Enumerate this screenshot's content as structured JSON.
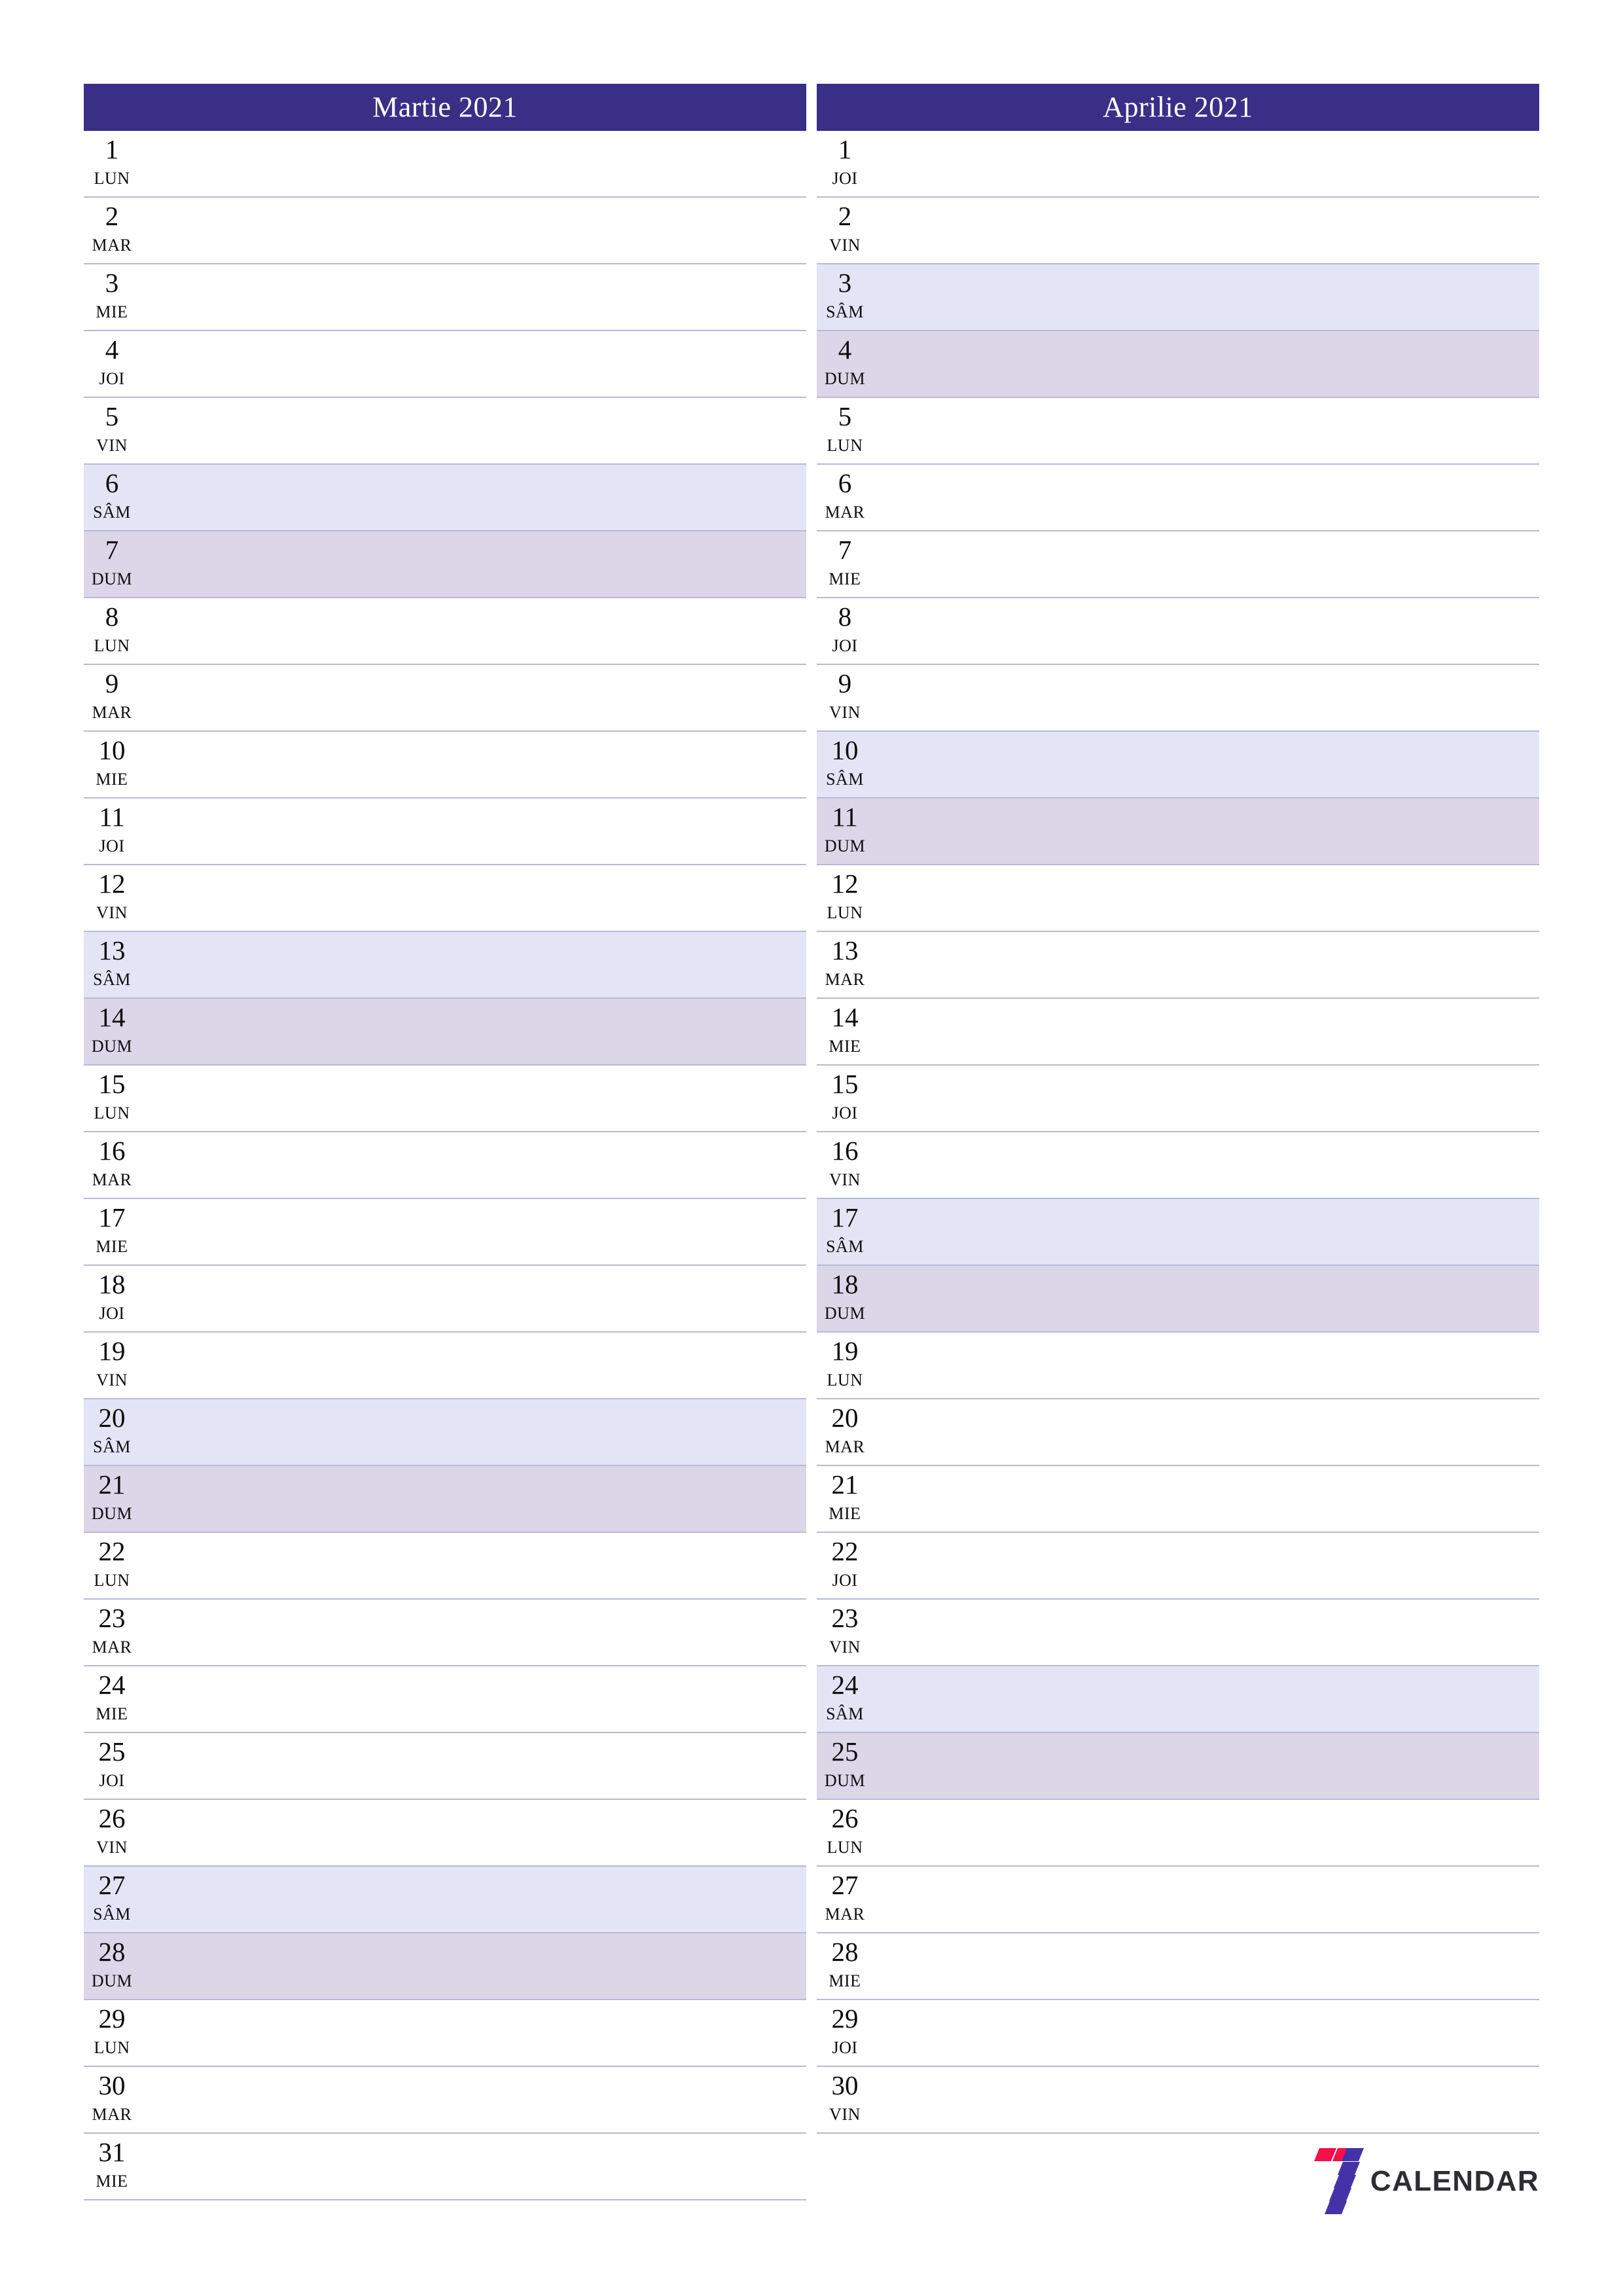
{
  "colors": {
    "header_bar": "#392f87",
    "saturday_row": "#e4e4f7",
    "sunday_row": "#dcd6e9",
    "row_separator": "#b9b9d6",
    "logo_red": "#f4104a",
    "logo_purple": "#4632a8",
    "logo_text": "#2d2d33"
  },
  "months": [
    {
      "title": "Martie 2021",
      "days": [
        {
          "num": "1",
          "abbr": "LUN",
          "type": "weekday"
        },
        {
          "num": "2",
          "abbr": "MAR",
          "type": "weekday"
        },
        {
          "num": "3",
          "abbr": "MIE",
          "type": "weekday"
        },
        {
          "num": "4",
          "abbr": "JOI",
          "type": "weekday"
        },
        {
          "num": "5",
          "abbr": "VIN",
          "type": "weekday"
        },
        {
          "num": "6",
          "abbr": "SÂM",
          "type": "saturday"
        },
        {
          "num": "7",
          "abbr": "DUM",
          "type": "sunday"
        },
        {
          "num": "8",
          "abbr": "LUN",
          "type": "weekday"
        },
        {
          "num": "9",
          "abbr": "MAR",
          "type": "weekday"
        },
        {
          "num": "10",
          "abbr": "MIE",
          "type": "weekday"
        },
        {
          "num": "11",
          "abbr": "JOI",
          "type": "weekday"
        },
        {
          "num": "12",
          "abbr": "VIN",
          "type": "weekday"
        },
        {
          "num": "13",
          "abbr": "SÂM",
          "type": "saturday"
        },
        {
          "num": "14",
          "abbr": "DUM",
          "type": "sunday"
        },
        {
          "num": "15",
          "abbr": "LUN",
          "type": "weekday"
        },
        {
          "num": "16",
          "abbr": "MAR",
          "type": "weekday"
        },
        {
          "num": "17",
          "abbr": "MIE",
          "type": "weekday"
        },
        {
          "num": "18",
          "abbr": "JOI",
          "type": "weekday"
        },
        {
          "num": "19",
          "abbr": "VIN",
          "type": "weekday"
        },
        {
          "num": "20",
          "abbr": "SÂM",
          "type": "saturday"
        },
        {
          "num": "21",
          "abbr": "DUM",
          "type": "sunday"
        },
        {
          "num": "22",
          "abbr": "LUN",
          "type": "weekday"
        },
        {
          "num": "23",
          "abbr": "MAR",
          "type": "weekday"
        },
        {
          "num": "24",
          "abbr": "MIE",
          "type": "weekday"
        },
        {
          "num": "25",
          "abbr": "JOI",
          "type": "weekday"
        },
        {
          "num": "26",
          "abbr": "VIN",
          "type": "weekday"
        },
        {
          "num": "27",
          "abbr": "SÂM",
          "type": "saturday"
        },
        {
          "num": "28",
          "abbr": "DUM",
          "type": "sunday"
        },
        {
          "num": "29",
          "abbr": "LUN",
          "type": "weekday"
        },
        {
          "num": "30",
          "abbr": "MAR",
          "type": "weekday"
        },
        {
          "num": "31",
          "abbr": "MIE",
          "type": "weekday"
        }
      ]
    },
    {
      "title": "Aprilie 2021",
      "days": [
        {
          "num": "1",
          "abbr": "JOI",
          "type": "weekday"
        },
        {
          "num": "2",
          "abbr": "VIN",
          "type": "weekday"
        },
        {
          "num": "3",
          "abbr": "SÂM",
          "type": "saturday"
        },
        {
          "num": "4",
          "abbr": "DUM",
          "type": "sunday"
        },
        {
          "num": "5",
          "abbr": "LUN",
          "type": "weekday"
        },
        {
          "num": "6",
          "abbr": "MAR",
          "type": "weekday"
        },
        {
          "num": "7",
          "abbr": "MIE",
          "type": "weekday"
        },
        {
          "num": "8",
          "abbr": "JOI",
          "type": "weekday"
        },
        {
          "num": "9",
          "abbr": "VIN",
          "type": "weekday"
        },
        {
          "num": "10",
          "abbr": "SÂM",
          "type": "saturday"
        },
        {
          "num": "11",
          "abbr": "DUM",
          "type": "sunday"
        },
        {
          "num": "12",
          "abbr": "LUN",
          "type": "weekday"
        },
        {
          "num": "13",
          "abbr": "MAR",
          "type": "weekday"
        },
        {
          "num": "14",
          "abbr": "MIE",
          "type": "weekday"
        },
        {
          "num": "15",
          "abbr": "JOI",
          "type": "weekday"
        },
        {
          "num": "16",
          "abbr": "VIN",
          "type": "weekday"
        },
        {
          "num": "17",
          "abbr": "SÂM",
          "type": "saturday"
        },
        {
          "num": "18",
          "abbr": "DUM",
          "type": "sunday"
        },
        {
          "num": "19",
          "abbr": "LUN",
          "type": "weekday"
        },
        {
          "num": "20",
          "abbr": "MAR",
          "type": "weekday"
        },
        {
          "num": "21",
          "abbr": "MIE",
          "type": "weekday"
        },
        {
          "num": "22",
          "abbr": "JOI",
          "type": "weekday"
        },
        {
          "num": "23",
          "abbr": "VIN",
          "type": "weekday"
        },
        {
          "num": "24",
          "abbr": "SÂM",
          "type": "saturday"
        },
        {
          "num": "25",
          "abbr": "DUM",
          "type": "sunday"
        },
        {
          "num": "26",
          "abbr": "LUN",
          "type": "weekday"
        },
        {
          "num": "27",
          "abbr": "MAR",
          "type": "weekday"
        },
        {
          "num": "28",
          "abbr": "MIE",
          "type": "weekday"
        },
        {
          "num": "29",
          "abbr": "JOI",
          "type": "weekday"
        },
        {
          "num": "30",
          "abbr": "VIN",
          "type": "weekday"
        }
      ]
    }
  ],
  "logo": {
    "icon_name": "seven-calendar-logo",
    "text": "CALENDAR"
  }
}
